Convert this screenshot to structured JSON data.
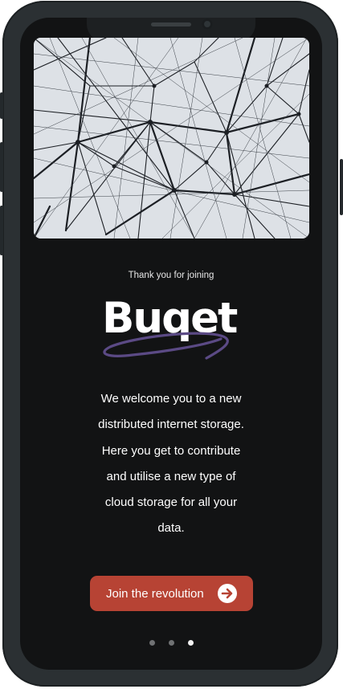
{
  "onboarding": {
    "subtitle": "Thank you for joining",
    "brand_name": "Buqet",
    "welcome_text": "We welcome you to a new distributed internet storage. Here you get to contribute and utilise a new type of cloud storage for all your data.",
    "cta_label": "Join the revolution",
    "cta_icon": "arrow-right-circle-icon",
    "hero_image": "network-mesh-image",
    "pages": [
      {
        "active": false
      },
      {
        "active": false
      },
      {
        "active": true
      }
    ]
  },
  "colors": {
    "background": "#121314",
    "accent": "#b74334",
    "brand_underline": "#5b4a85"
  }
}
